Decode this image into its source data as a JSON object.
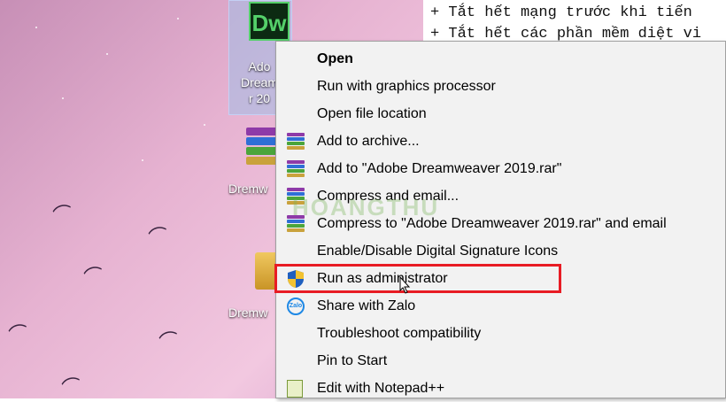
{
  "notes": {
    "line1": "+ Tắt hết mạng trước khi tiến",
    "line2": "+ Tắt hết các phần mềm diệt vi"
  },
  "desktop_icons": {
    "dreamweaver_logo": "Dw",
    "dreamweaver_label": "Ado\nDream\nr 20",
    "rar1_label": "Dremw",
    "rar2_label": "Dremw"
  },
  "watermark": "HOANGTHU",
  "context_menu": {
    "items": [
      {
        "label": "Open",
        "icon": "none",
        "bold": true
      },
      {
        "label": "Run with graphics processor",
        "icon": "none"
      },
      {
        "label": "Open file location",
        "icon": "none"
      },
      {
        "label": "Add to archive...",
        "icon": "winrar-icon"
      },
      {
        "label": "Add to \"Adobe Dreamweaver 2019.rar\"",
        "icon": "winrar-icon"
      },
      {
        "label": "Compress and email...",
        "icon": "winrar-icon"
      },
      {
        "label": "Compress to \"Adobe Dreamweaver 2019.rar\" and email",
        "icon": "winrar-icon"
      },
      {
        "label": "Enable/Disable Digital Signature Icons",
        "icon": "none"
      },
      {
        "label": "Run as administrator",
        "icon": "uac-shield-icon"
      },
      {
        "label": "Share with Zalo",
        "icon": "zalo-icon"
      },
      {
        "label": "Troubleshoot compatibility",
        "icon": "none"
      },
      {
        "label": "Pin to Start",
        "icon": "none"
      },
      {
        "label": "Edit with Notepad++",
        "icon": "notepad-plus-plus-icon"
      }
    ]
  },
  "colors": {
    "highlight_border": "#e81c24",
    "menu_background": "#f2f2f2",
    "dreamweaver_green": "#54d06a"
  }
}
